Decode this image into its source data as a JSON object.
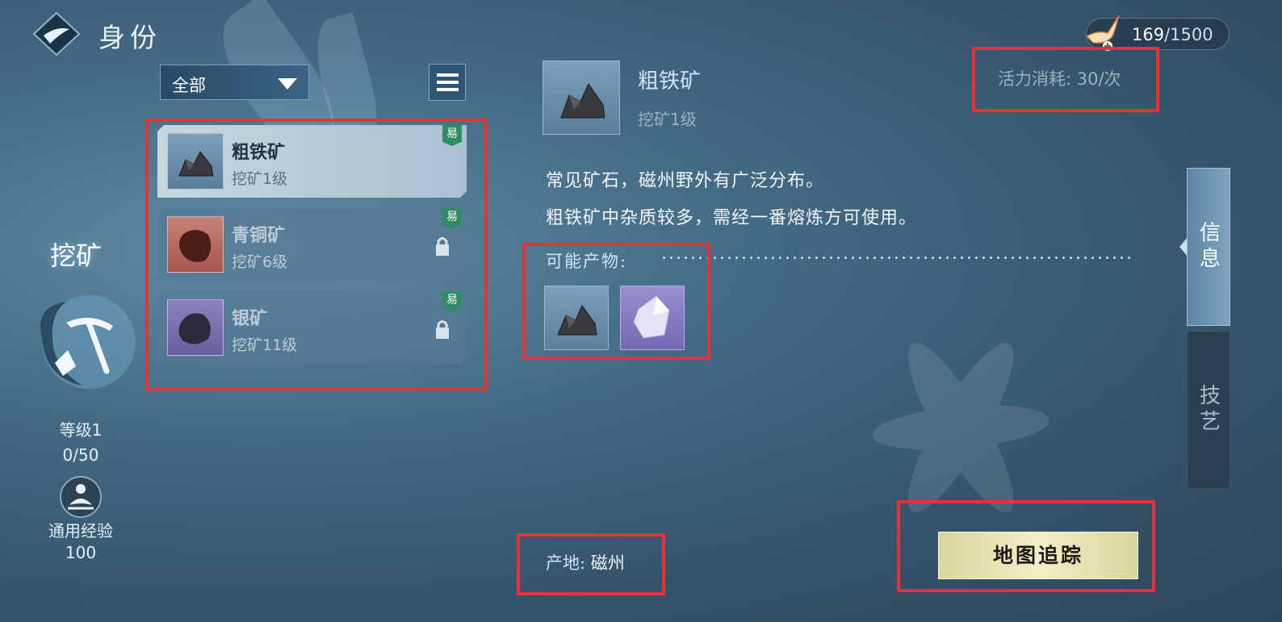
{
  "header": {
    "title": "身份",
    "stamina_current": "169",
    "stamina_max": "/1500"
  },
  "skill": {
    "name": "挖矿",
    "level": "等级1",
    "progress": "0/50",
    "general_exp_label": "通用经验",
    "general_exp_value": "100"
  },
  "filter": {
    "selected": "全部"
  },
  "ore_list": [
    {
      "name": "粗铁矿",
      "level": "挖矿1级",
      "tag": "易",
      "locked": false
    },
    {
      "name": "青铜矿",
      "level": "挖矿6级",
      "tag": "易",
      "locked": true
    },
    {
      "name": "银矿",
      "level": "挖矿11级",
      "tag": "易",
      "locked": true
    }
  ],
  "detail": {
    "name": "粗铁矿",
    "level": "挖矿1级",
    "cost": "活力消耗: 30/次",
    "desc_line1": "常见矿石，磁州野外有广泛分布。",
    "desc_line2": "粗铁矿中杂质较多，需经一番熔炼方可使用。",
    "products_label": "可能产物:",
    "origin_label": "产地:",
    "origin_value": "磁州",
    "track_button": "地图追踪"
  },
  "tabs": {
    "info": "信息",
    "craft": "技艺"
  },
  "colors": {
    "highlight": "#e53138",
    "accent_gold": "#f2efc6",
    "easy_tag": "#2f8c67",
    "rare_item": "#8e81c9"
  }
}
